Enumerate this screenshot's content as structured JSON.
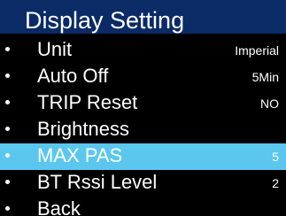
{
  "header": {
    "title": "Display Setting"
  },
  "menu": {
    "items": [
      {
        "label": "Unit",
        "value": "Imperial"
      },
      {
        "label": "Auto Off",
        "value": "5Min"
      },
      {
        "label": "TRIP Reset",
        "value": "NO"
      },
      {
        "label": "Brightness",
        "value": ""
      },
      {
        "label": "MAX PAS",
        "value": "5"
      },
      {
        "label": "BT Rssi Level",
        "value": "2"
      },
      {
        "label": "Back",
        "value": ""
      }
    ],
    "selected_label": "MAX PAS"
  },
  "colors": {
    "background": "#000000",
    "header_background": "#0a2b66",
    "selected_row": "#5bc7ee",
    "text": "#ffffff"
  }
}
